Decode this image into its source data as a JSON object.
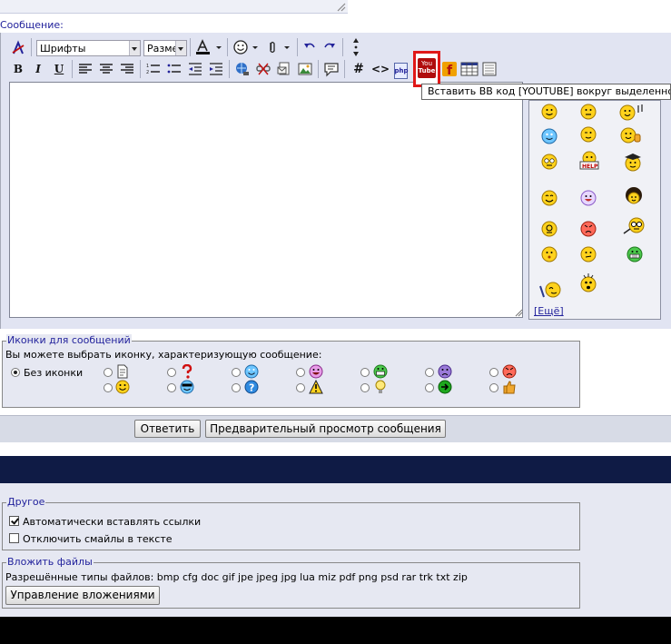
{
  "message_label": "Сообщение:",
  "toolbar": {
    "font_select": "Шрифты",
    "size_select": "Разме",
    "tooltip": "Вставить BB код [YOUTUBE] вокруг выделенного",
    "youtube_label_top": "You",
    "youtube_label_bottom": "Tube",
    "code_hash": "#",
    "code_brackets": "<>",
    "php_label": "php"
  },
  "smilies": {
    "more_link": "[Ещё]"
  },
  "post_icons": {
    "legend": "Иконки для сообщений",
    "description": "Вы можете выбрать иконку, характеризующую сообщение:",
    "no_icon_label": "Без иконки",
    "selected": "no-icon"
  },
  "buttons": {
    "reply": "Ответить",
    "preview": "Предварительный просмотр сообщения"
  },
  "other": {
    "legend": "Другое",
    "auto_links": "Автоматически вставлять ссылки",
    "auto_links_checked": true,
    "disable_smilies": "Отключить смайлы в тексте",
    "disable_smilies_checked": false
  },
  "attachments": {
    "legend": "Вложить файлы",
    "allowed_types": "Разрешённые типы файлов: bmp cfg doc gif jpe jpeg jpg lua miz pdf png psd rar trk txt zip",
    "manage_button": "Управление вложениями"
  },
  "colors": {
    "accent": "#22229c",
    "highlight": "#e01818",
    "dark_band": "#0f1b45"
  }
}
